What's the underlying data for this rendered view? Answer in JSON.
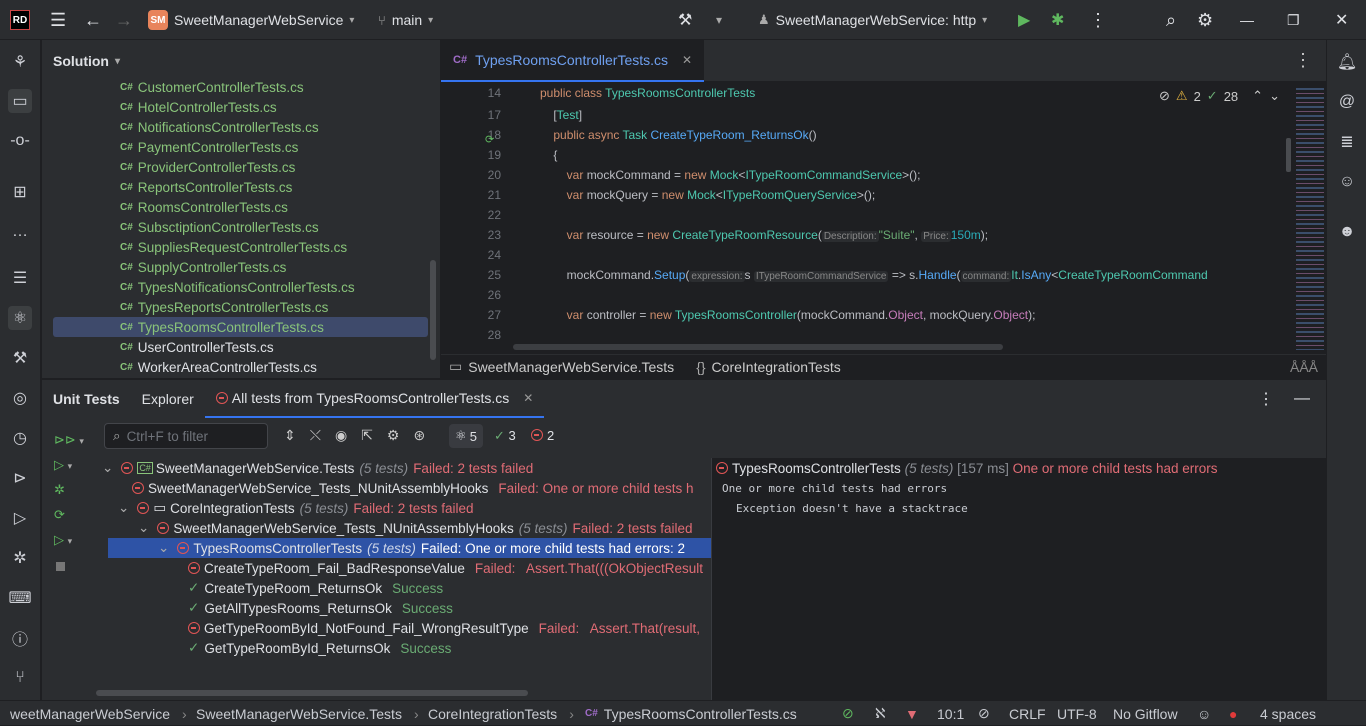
{
  "titlebar": {
    "project": "SweetManagerWebService",
    "project_badge": "SM",
    "branch": "main",
    "run_config": "SweetManagerWebService: http"
  },
  "solution": {
    "title": "Solution",
    "files": [
      "CustomerControllerTests.cs",
      "HotelControllerTests.cs",
      "NotificationsControllerTests.cs",
      "PaymentControllerTests.cs",
      "ProviderControllerTests.cs",
      "ReportsControllerTests.cs",
      "RoomsControllerTests.cs",
      "SubsctiptionControllerTests.cs",
      "SuppliesRequestControllerTests.cs",
      "SupplyControllerTests.cs",
      "TypesNotificationsControllerTests.cs",
      "TypesReportsControllerTests.cs",
      "TypesRoomsControllerTests.cs",
      "UserControllerTests.cs",
      "WorkerAreaControllerTests.cs"
    ]
  },
  "editor": {
    "tab": "TypesRoomsControllerTests.cs",
    "warnings": "2",
    "checks": "28",
    "lines": [
      "14",
      "17",
      "18",
      "19",
      "20",
      "21",
      "22",
      "23",
      "24",
      "25",
      "26",
      "27",
      "28"
    ],
    "breadcrumb": [
      "SweetManagerWebService.Tests",
      "CoreIntegrationTests"
    ]
  },
  "unit_tests": {
    "tabs": [
      "Unit Tests",
      "Explorer",
      "All tests from TypesRoomsControllerTests.cs"
    ],
    "filter_placeholder": "Ctrl+F to filter",
    "total": "5",
    "passed": "3",
    "failed": "2",
    "tree": [
      {
        "name": "SweetManagerWebService.Tests",
        "count": "(5 tests)",
        "status": "Failed: 2 tests failed"
      },
      {
        "name": "SweetManagerWebService_Tests_NUnitAssemblyHooks",
        "count": "",
        "status": "Failed: One or more child tests h"
      },
      {
        "name": "CoreIntegrationTests",
        "count": "(5 tests)",
        "status": "Failed: 2 tests failed"
      },
      {
        "name": "SweetManagerWebService_Tests_NUnitAssemblyHooks",
        "count": "(5 tests)",
        "status": "Failed: 2 tests failed"
      },
      {
        "name": "TypesRoomsControllerTests",
        "count": "(5 tests)",
        "status": "Failed: One or more child tests had errors: 2"
      },
      {
        "name": "CreateTypeRoom_Fail_BadResponseValue",
        "count": "",
        "status": "Failed:   Assert.That(((OkObjectResult"
      },
      {
        "name": "CreateTypeRoom_ReturnsOk",
        "count": "",
        "status": "Success"
      },
      {
        "name": "GetAllTypesRooms_ReturnsOk",
        "count": "",
        "status": "Success"
      },
      {
        "name": "GetTypeRoomById_NotFound_Fail_WrongResultType",
        "count": "",
        "status": "Failed:   Assert.That(result,"
      },
      {
        "name": "GetTypeRoomById_ReturnsOk",
        "count": "",
        "status": "Success"
      }
    ],
    "detail": {
      "name": "TypesRoomsControllerTests",
      "count": "(5 tests)",
      "time": "[157 ms]",
      "status": "One or more child tests had errors",
      "line1": "One or more child tests had errors",
      "line2": "Exception doesn't have a stacktrace"
    }
  },
  "status": {
    "crumbs": [
      "weetManagerWebService",
      "SweetManagerWebService.Tests",
      "CoreIntegrationTests",
      "TypesRoomsControllerTests.cs"
    ],
    "position": "10:1",
    "line_ending": "CRLF",
    "encoding": "UTF-8",
    "vcs": "No Gitflow",
    "indent": "4 spaces"
  }
}
